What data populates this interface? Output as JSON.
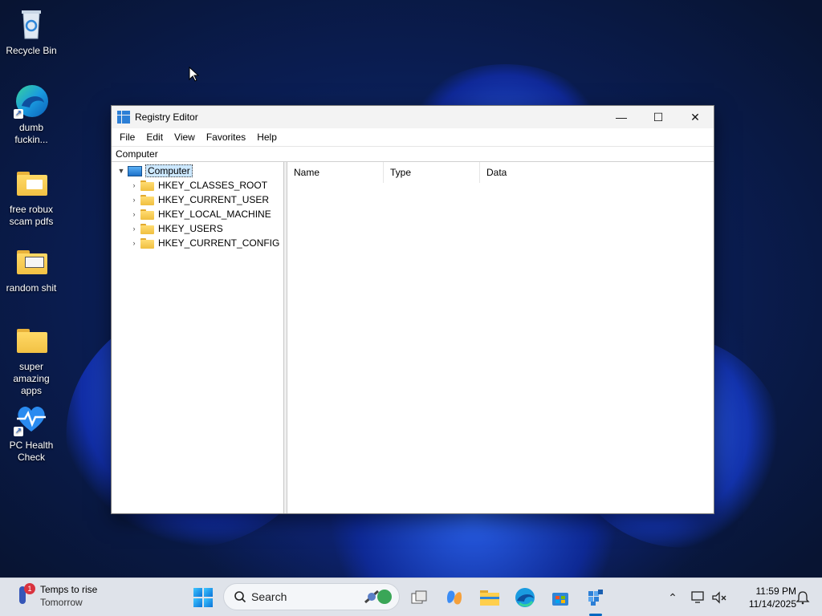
{
  "desktop": {
    "icons": [
      {
        "label": "Recycle Bin"
      },
      {
        "label": "dumb fuckin..."
      },
      {
        "label": "free robux scam pdfs"
      },
      {
        "label": "random shit"
      },
      {
        "label": "super amazing apps"
      },
      {
        "label": "PC Health Check"
      }
    ]
  },
  "window": {
    "title": "Registry Editor",
    "controls": {
      "minimize": "—",
      "maximize": "☐",
      "close": "✕"
    },
    "menu": [
      "File",
      "Edit",
      "View",
      "Favorites",
      "Help"
    ],
    "address": "Computer",
    "tree": {
      "root": "Computer",
      "children": [
        "HKEY_CLASSES_ROOT",
        "HKEY_CURRENT_USER",
        "HKEY_LOCAL_MACHINE",
        "HKEY_USERS",
        "HKEY_CURRENT_CONFIG"
      ]
    },
    "columns": [
      "Name",
      "Type",
      "Data"
    ]
  },
  "taskbar": {
    "weather": {
      "line1": "Temps to rise",
      "line2": "Tomorrow",
      "badge": "1"
    },
    "search_placeholder": "Search",
    "clock": {
      "time": "11:59 PM",
      "date": "11/14/2025"
    }
  },
  "colors": {
    "accent": "#0067c0",
    "selection": "#cce8ff",
    "taskbar": "#dfe3ea"
  }
}
